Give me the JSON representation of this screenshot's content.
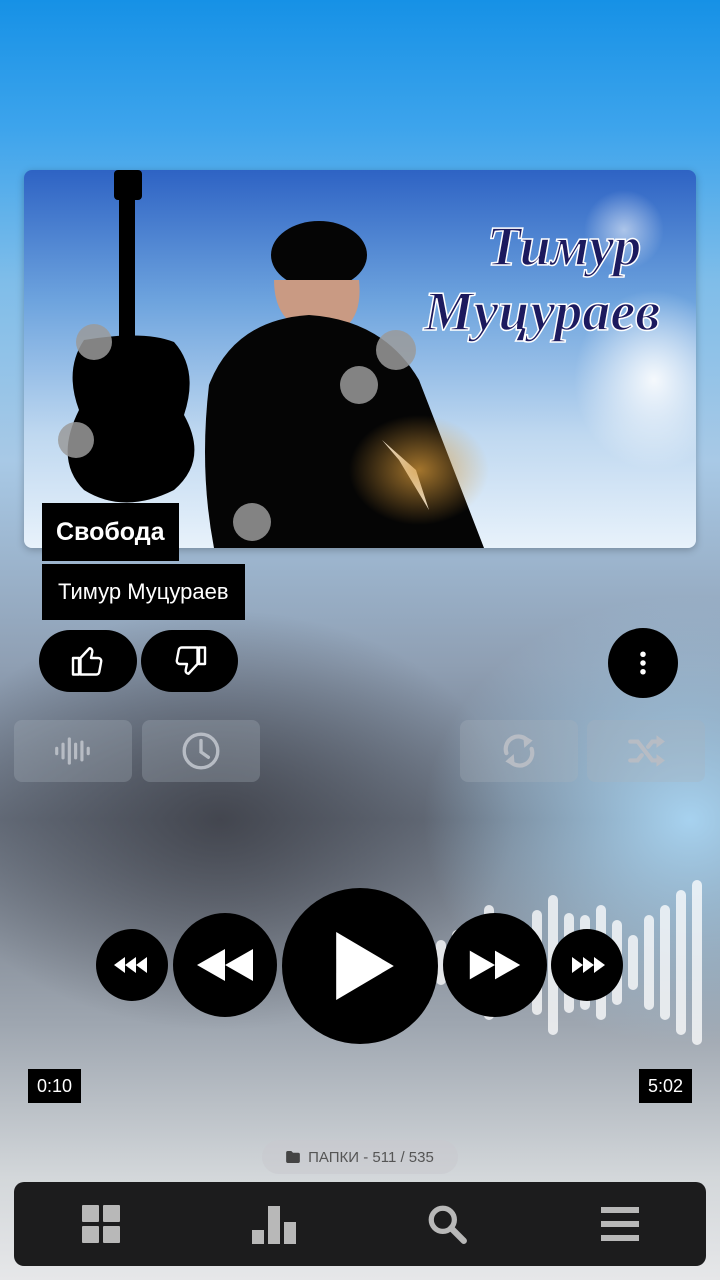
{
  "track": {
    "title": "Свобода",
    "artist": "Тимур Муцураев",
    "art_caption_line1": "Тимур",
    "art_caption_line2": "Муцураев"
  },
  "progress": {
    "elapsed": "0:10",
    "duration": "5:02",
    "fraction": 0.033
  },
  "folders": {
    "label": "ПАПКИ - 511 / 535"
  },
  "icons": {
    "like": "thumbs-up-icon",
    "dislike": "thumbs-down-icon",
    "more": "more-vertical-icon",
    "equalizer": "waveform-icon",
    "sleep_timer": "clock-icon",
    "repeat": "repeat-icon",
    "shuffle": "shuffle-icon",
    "seek_back": "fast-rewind-icon",
    "previous": "rewind-icon",
    "play": "play-icon",
    "next": "fast-forward-icon",
    "seek_forward": "skip-forward-icon",
    "nav_grid": "grid-icon",
    "nav_stats": "bar-chart-icon",
    "nav_search": "search-icon",
    "nav_menu": "menu-icon",
    "folder": "folder-icon"
  },
  "colors": {
    "button_bg": "#000000",
    "nav_bg": "#1c1c1d",
    "nav_icon": "#b8b8b8",
    "ghost_icon": "#b7bcc4"
  }
}
